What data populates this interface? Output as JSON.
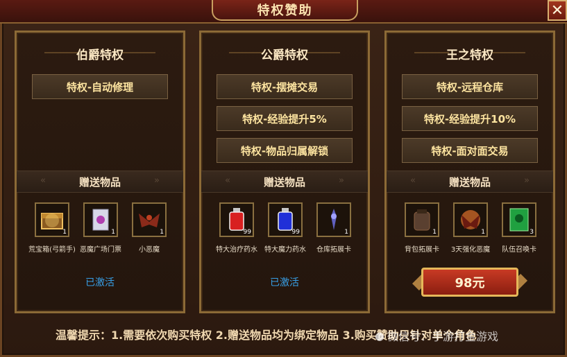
{
  "title": "特权赞助",
  "close_label": "✕",
  "panels": [
    {
      "title": "伯爵特权",
      "privileges": [
        "特权-自动修理"
      ],
      "gift_label": "赠送物品",
      "items": [
        {
          "name": "荒宝箱(弓箭手)",
          "count": "1",
          "icon": "treasure-chest-icon"
        },
        {
          "name": "恶魔广场门票",
          "count": "1",
          "icon": "ticket-icon"
        },
        {
          "name": "小恶魔",
          "count": "1",
          "icon": "demon-icon"
        }
      ],
      "status": "已激活"
    },
    {
      "title": "公爵特权",
      "privileges": [
        "特权-摆摊交易",
        "特权-经验提升5%",
        "特权-物品归属解锁"
      ],
      "gift_label": "赠送物品",
      "items": [
        {
          "name": "特大治疗药水",
          "count": "99",
          "icon": "red-potion-icon"
        },
        {
          "name": "特大魔力药水",
          "count": "99",
          "icon": "blue-potion-icon"
        },
        {
          "name": "仓库拓展卡",
          "count": "1",
          "icon": "storage-card-icon"
        }
      ],
      "status": "已激活"
    },
    {
      "title": "王之特权",
      "privileges": [
        "特权-远程仓库",
        "特权-经验提升10%",
        "特权-面对面交易"
      ],
      "gift_label": "赠送物品",
      "items": [
        {
          "name": "背包拓展卡",
          "count": "1",
          "icon": "backpack-icon"
        },
        {
          "name": "3天强化恶魔",
          "count": "1",
          "icon": "fire-demon-icon"
        },
        {
          "name": "队伍召唤卡",
          "count": "3",
          "icon": "summon-card-icon"
        }
      ],
      "buy_label": "98元"
    }
  ],
  "tip": "温馨提示：1.需要依次购买特权 2.赠送物品均为绑定物品 3.购买赞助只针对单个角色",
  "watermark": "微信号：手游打金游戏",
  "colors": {
    "accent_gold": "#c9a060",
    "activated_blue": "#38a0e8",
    "buy_red": "#c83a24"
  }
}
